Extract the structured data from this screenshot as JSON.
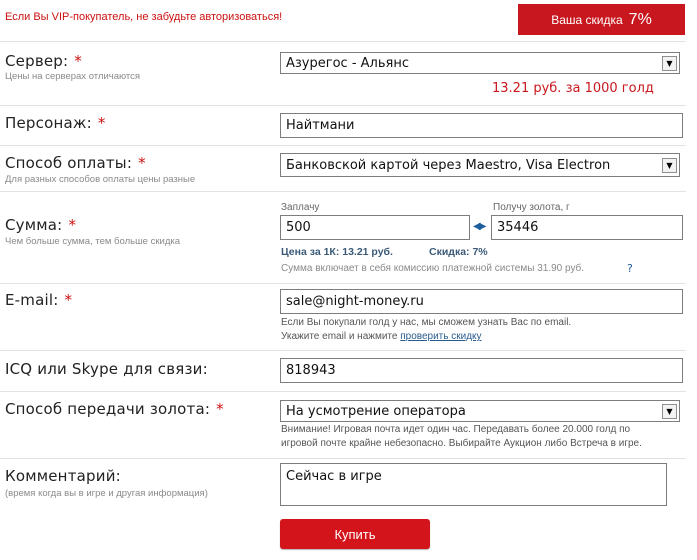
{
  "header": {
    "vip_note": "Если Вы VIP-покупатель, не забудьте авторизоваться!",
    "discount_label": "Ваша скидка",
    "discount_value": "7%"
  },
  "server": {
    "label": "Сервер:",
    "required_mark": "*",
    "hint": "Цены на серверах отличаются",
    "selected": "Азурегос - Альянс",
    "price_note": "13.21 руб. за 1000 голд"
  },
  "character": {
    "label": "Персонаж:",
    "required_mark": "*",
    "value": "Найтмани"
  },
  "payment": {
    "label": "Способ оплаты:",
    "required_mark": "*",
    "hint": "Для разных способов оплаты цены разные",
    "selected": "Банковской картой через Maestro, Visa Electron"
  },
  "amount": {
    "label": "Сумма:",
    "required_mark": "*",
    "hint": "Чем больше сумма, тем больше скидка",
    "pay_label": "Заплачу",
    "pay_value": "500",
    "gold_label": "Получу золота, г",
    "gold_value": "35446",
    "price_per_k": "Цена за 1К: 13.21 руб.",
    "discount": "Скидка: 7%",
    "commission_note": "Сумма включает в себя комиссию платежной системы 31.90 руб.",
    "help": "?"
  },
  "email": {
    "label": "E-mail:",
    "required_mark": "*",
    "value": "sale@night-money.ru",
    "info_line1": "Если Вы покупали голд у нас, мы сможем узнать Вас по email.",
    "info_line2": "Укажите email и нажмите",
    "check_link": "проверить скидку"
  },
  "contact": {
    "label": "ICQ или Skype для связи:",
    "value": "818943"
  },
  "delivery": {
    "label": "Способ передачи золота:",
    "required_mark": "*",
    "selected": "На усмотрение оператора",
    "warning_line1": "Внимание! Игровая почта идет один час. Передавать более 20.000 голд по",
    "warning_line2": "игровой почте крайне небезопасно. Выбирайте Аукцион либо Встреча в игре."
  },
  "comment": {
    "label": "Комментарий:",
    "hint": "(время когда вы в игре и другая информация)",
    "value": "Сейчас в игре"
  },
  "buy_button": "Купить",
  "colors": {
    "accent_red": "#c8171e",
    "link_blue": "#2a5d8f"
  }
}
